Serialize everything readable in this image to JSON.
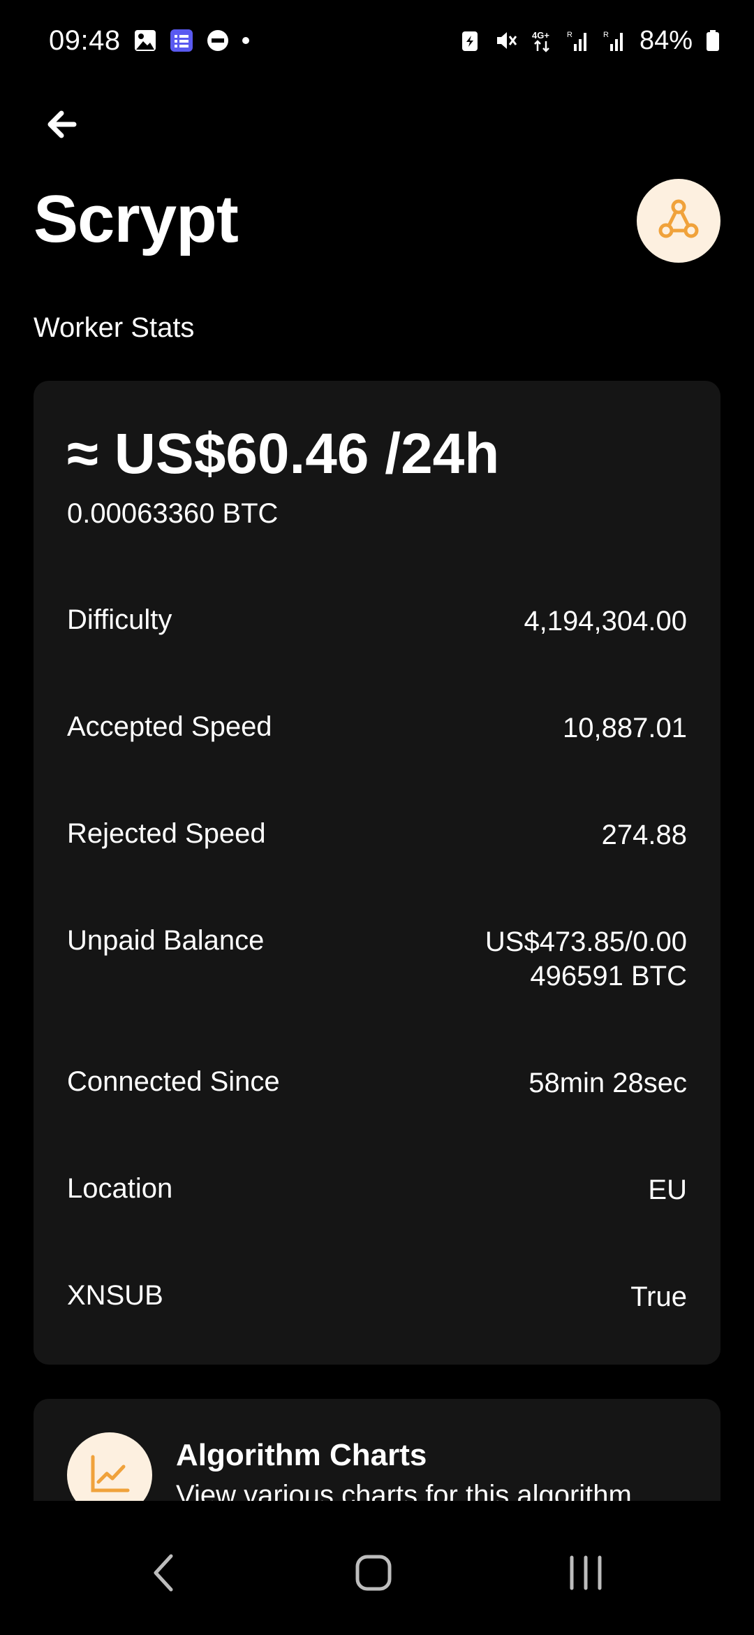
{
  "status_bar": {
    "time": "09:48",
    "battery": "84%",
    "left_icons": [
      "gallery-icon",
      "tasks-icon",
      "do-not-disturb-icon",
      "dot-icon"
    ],
    "right_icons": [
      "battery-saver-icon",
      "mute-icon",
      "4g-icon",
      "signal-icon",
      "signal-icon",
      "battery-icon"
    ]
  },
  "header": {
    "back_icon": "arrow-left-icon",
    "title": "Scrypt",
    "subtitle": "Worker Stats",
    "algo_icon": "algorithm-nodes-icon"
  },
  "stats": {
    "earnings_usd": "≈ US$60.46 /24h",
    "earnings_btc": "0.00063360 BTC",
    "rows": [
      {
        "label": "Difficulty",
        "value": "4,194,304.00"
      },
      {
        "label": "Accepted Speed",
        "value": "10,887.01"
      },
      {
        "label": "Rejected Speed",
        "value": "274.88"
      },
      {
        "label": "Unpaid Balance",
        "value": "US$473.85/0.00496591 BTC"
      },
      {
        "label": "Connected Since",
        "value": "58min 28sec"
      },
      {
        "label": "Location",
        "value": "EU"
      },
      {
        "label": "XNSUB",
        "value": "True"
      }
    ]
  },
  "charts_card": {
    "icon": "line-chart-icon",
    "title": "Algorithm Charts",
    "description": "View various charts for this algorithm"
  },
  "nav": {
    "back_icon": "nav-back-icon",
    "home_icon": "nav-home-icon",
    "recents_icon": "nav-recents-icon"
  },
  "colors": {
    "background": "#000000",
    "card": "#151515",
    "accent": "#f0a23b",
    "badge_bg": "#fdf0e0"
  }
}
